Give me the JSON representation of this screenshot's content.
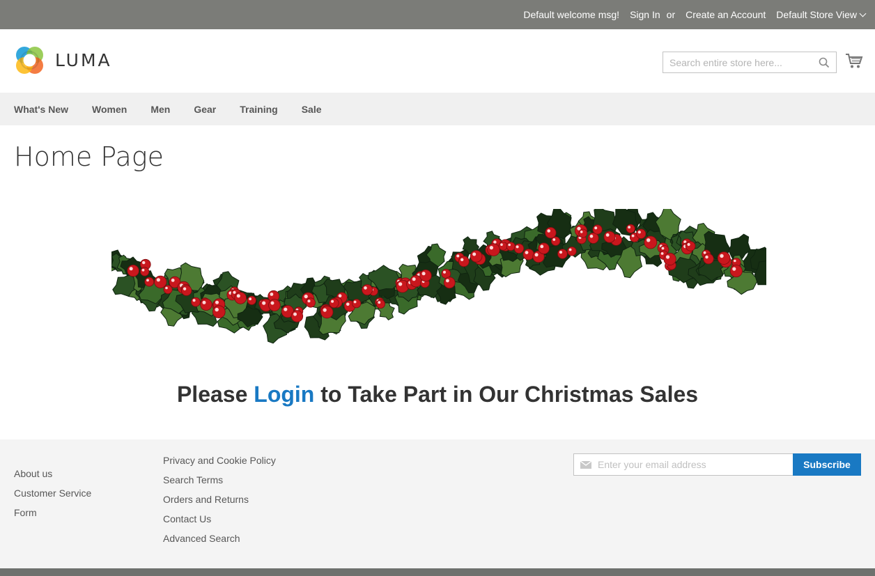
{
  "topbar": {
    "welcome": "Default welcome msg!",
    "sign_in": "Sign In",
    "or": "or",
    "create_account": "Create an Account",
    "store_view": "Default Store View"
  },
  "header": {
    "logo_text": "LUMA",
    "search_placeholder": "Search entire store here..."
  },
  "nav": {
    "items": [
      "What's New",
      "Women",
      "Men",
      "Gear",
      "Training",
      "Sale"
    ]
  },
  "main": {
    "page_title": "Home Page",
    "promo": {
      "before": "Please",
      "link": "Login",
      "after": "to Take Part in Our Christmas Sales"
    }
  },
  "footer": {
    "col1": [
      "About us",
      "Customer Service",
      "Form"
    ],
    "col2": [
      "Privacy and Cookie Policy",
      "Search Terms",
      "Orders and Returns",
      "Contact Us",
      "Advanced Search"
    ],
    "newsletter": {
      "placeholder": "Enter your email address",
      "button": "Subscribe"
    }
  },
  "colors": {
    "topbar": "#7b7c78",
    "accent": "#1979c3",
    "nav_bg": "#f0f0f0",
    "footer_bg": "#f4f4f4"
  },
  "icons": [
    "luma-logo-icon",
    "search-icon",
    "cart-icon",
    "chevron-down-icon",
    "mail-icon",
    "holly-garland-image"
  ]
}
